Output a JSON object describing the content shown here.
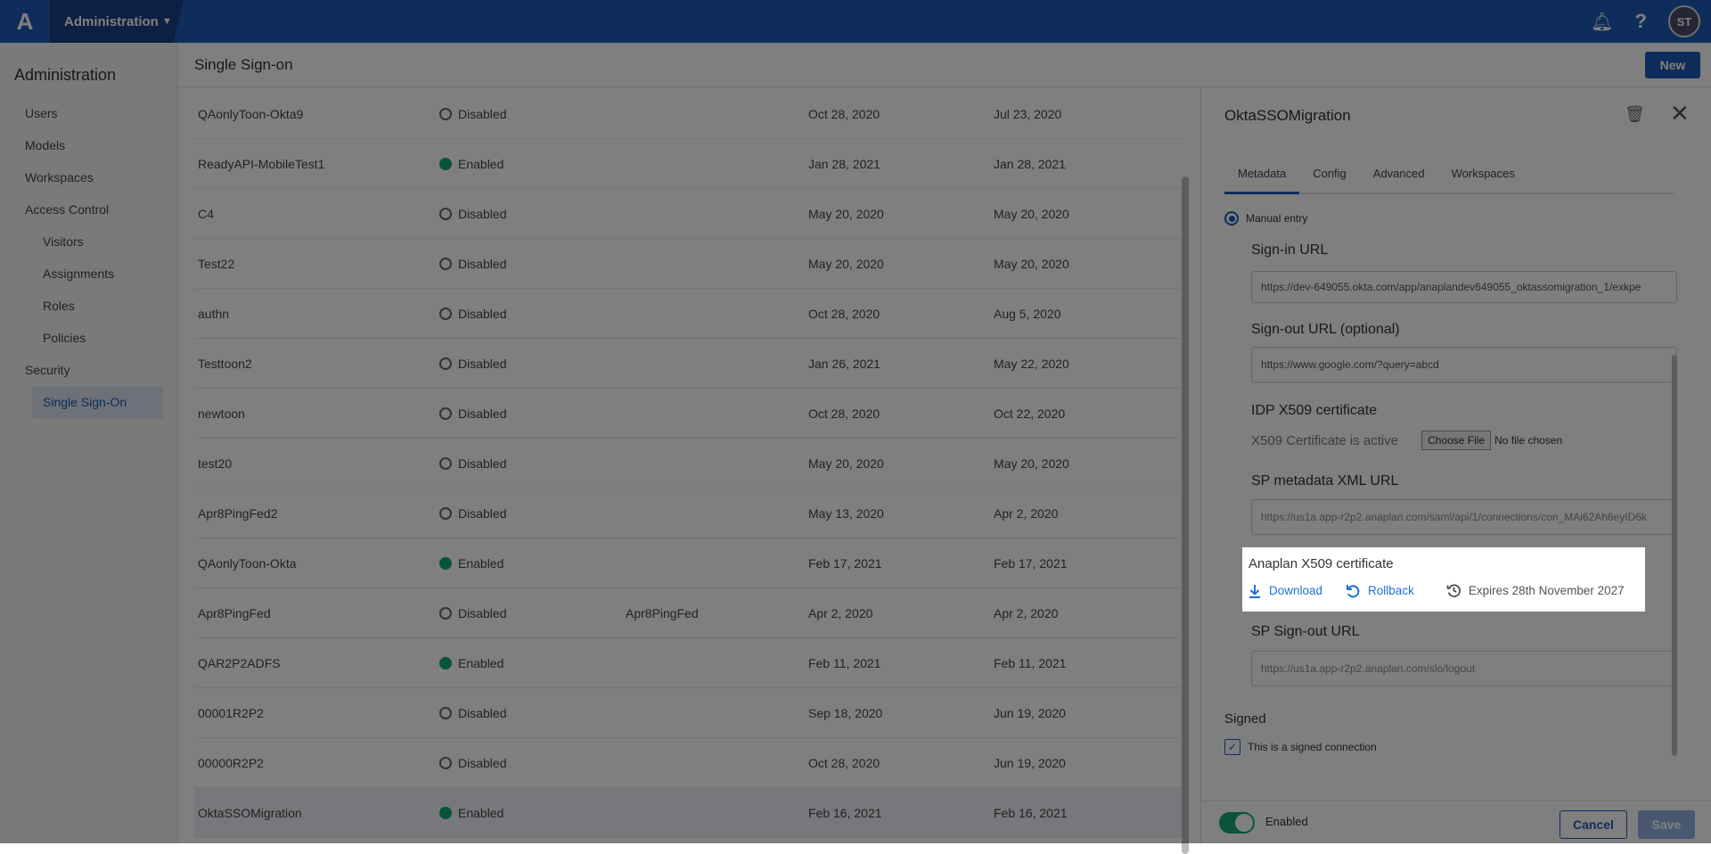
{
  "topbar": {
    "app": "Administration",
    "avatar": "ST",
    "icons": [
      "bell-icon",
      "help-icon"
    ]
  },
  "sidebar": {
    "title": "Administration",
    "items": [
      {
        "label": "Users",
        "sub": false
      },
      {
        "label": "Models",
        "sub": false
      },
      {
        "label": "Workspaces",
        "sub": false
      },
      {
        "label": "Access Control",
        "sub": false
      },
      {
        "label": "Visitors",
        "sub": true
      },
      {
        "label": "Assignments",
        "sub": true
      },
      {
        "label": "Roles",
        "sub": true
      },
      {
        "label": "Policies",
        "sub": true
      },
      {
        "label": "Security",
        "sub": false
      },
      {
        "label": "Single Sign-On",
        "sub": true,
        "active": true
      }
    ]
  },
  "main": {
    "title": "Single Sign-on",
    "new_label": "New",
    "rows": [
      [
        "QAonlyToon-Okta9",
        "Disabled",
        "",
        "Oct 28, 2020",
        "Jul 23, 2020"
      ],
      [
        "ReadyAPI-MobileTest1",
        "Enabled",
        "",
        "Jan 28, 2021",
        "Jan 28, 2021"
      ],
      [
        "C4",
        "Disabled",
        "",
        "May 20, 2020",
        "May 20, 2020"
      ],
      [
        "Test22",
        "Disabled",
        "",
        "May 20, 2020",
        "May 20, 2020"
      ],
      [
        "authn",
        "Disabled",
        "",
        "Oct 28, 2020",
        "Aug 5, 2020"
      ],
      [
        "Testtoon2",
        "Disabled",
        "",
        "Jan 26, 2021",
        "May 22, 2020"
      ],
      [
        "newtoon",
        "Disabled",
        "",
        "Oct 28, 2020",
        "Oct 22, 2020"
      ],
      [
        "test20",
        "Disabled",
        "",
        "May 20, 2020",
        "May 20, 2020"
      ],
      [
        "Apr8PingFed2",
        "Disabled",
        "",
        "May 13, 2020",
        "Apr 2, 2020"
      ],
      [
        "QAonlyToon-Okta",
        "Enabled",
        "",
        "Feb 17, 2021",
        "Feb 17, 2021"
      ],
      [
        "Apr8PingFed",
        "Disabled",
        "Apr8PingFed",
        "Apr 2, 2020",
        "Apr 2, 2020"
      ],
      [
        "QAR2P2ADFS",
        "Enabled",
        "",
        "Feb 11, 2021",
        "Feb 11, 2021"
      ],
      [
        "00001R2P2",
        "Disabled",
        "",
        "Sep 18, 2020",
        "Jun 19, 2020"
      ],
      [
        "00000R2P2",
        "Disabled",
        "",
        "Oct 28, 2020",
        "Jun 19, 2020"
      ],
      [
        "OktaSSOMigration",
        "Enabled",
        "",
        "Feb 16, 2021",
        "Feb 16, 2021"
      ]
    ]
  },
  "panel": {
    "title": "OktaSSOMigration",
    "tabs": [
      "Metadata",
      "Config",
      "Advanced",
      "Workspaces"
    ],
    "manual_entry": "Manual entry",
    "signin_label": "Sign-in URL",
    "signin_value": "https://dev-649055.okta.com/app/anaplandev649055_oktassomigration_1/exkpe",
    "signout_label": "Sign-out URL (optional)",
    "signout_value": "https://www.google.com/?query=abcd",
    "idp_label": "IDP X509 certificate",
    "idp_status": "X509 Certificate is active",
    "choose_file": "Choose File",
    "no_file": "No file chosen",
    "sp_meta_label": "SP metadata XML URL",
    "sp_meta_value": "https://us1a.app-r2p2.anaplan.com/saml/api/1/connections/con_MAi62Ah6eyID6k",
    "cert_label": "Anaplan X509 certificate",
    "download": "Download",
    "rollback": "Rollback",
    "expires": "Expires 28th November 2027",
    "sp_signout_label": "SP Sign-out URL",
    "sp_signout_value": "https://us1a.app-r2p2.anaplan.com/slo/logout",
    "signed_label": "Signed",
    "signed_checkbox": "This is a signed connection",
    "enabled_label": "Enabled",
    "cancel": "Cancel",
    "save": "Save"
  },
  "colors": {
    "brand": "#1f5bb5",
    "enabled": "#17a673",
    "link": "#1f6fd6"
  }
}
